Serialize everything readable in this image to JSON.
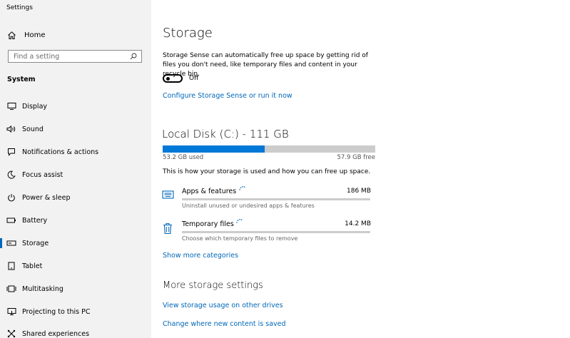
{
  "window": {
    "title": "Settings"
  },
  "sidebar": {
    "home_label": "Home",
    "search_placeholder": "Find a setting",
    "section_label": "System",
    "items": [
      {
        "label": "Display",
        "icon": "display-icon"
      },
      {
        "label": "Sound",
        "icon": "sound-icon"
      },
      {
        "label": "Notifications & actions",
        "icon": "notifications-icon"
      },
      {
        "label": "Focus assist",
        "icon": "moon-icon"
      },
      {
        "label": "Power & sleep",
        "icon": "power-icon"
      },
      {
        "label": "Battery",
        "icon": "battery-icon"
      },
      {
        "label": "Storage",
        "icon": "storage-icon",
        "selected": true
      },
      {
        "label": "Tablet",
        "icon": "tablet-icon"
      },
      {
        "label": "Multitasking",
        "icon": "multitasking-icon"
      },
      {
        "label": "Projecting to this PC",
        "icon": "projecting-icon"
      },
      {
        "label": "Shared experiences",
        "icon": "shared-experiences-icon"
      }
    ]
  },
  "main": {
    "title": "Storage",
    "description": "Storage Sense can automatically free up space by getting rid of files you don't need, like temporary files and content in your recycle bin.",
    "storage_sense_toggle": {
      "state_label": "Off",
      "on": false
    },
    "configure_link": "Configure Storage Sense or run it now",
    "disk": {
      "title": "Local Disk (C:) - 111 GB",
      "used_label": "53.2 GB used",
      "free_label": "57.9 GB free",
      "used_fraction": 0.479
    },
    "usage_info": "This is how your storage is used and how you can free up space.",
    "categories": [
      {
        "name": "Apps & features",
        "size": "186 MB",
        "description": "Uninstall unused or undesired apps & features",
        "icon": "apps-features-icon"
      },
      {
        "name": "Temporary files",
        "size": "14.2 MB",
        "description": "Choose which temporary files to remove",
        "icon": "trash-icon"
      }
    ],
    "show_more_link": "Show more categories",
    "more_settings_title": "More storage settings",
    "more_links": [
      "View storage usage on other drives",
      "Change where new content is saved"
    ]
  },
  "colors": {
    "accent": "#0067c0",
    "link": "#0067b8",
    "bar_fill": "#0078d7",
    "bar_track": "#cccccc",
    "sidebar_bg": "#f2f2f2"
  }
}
